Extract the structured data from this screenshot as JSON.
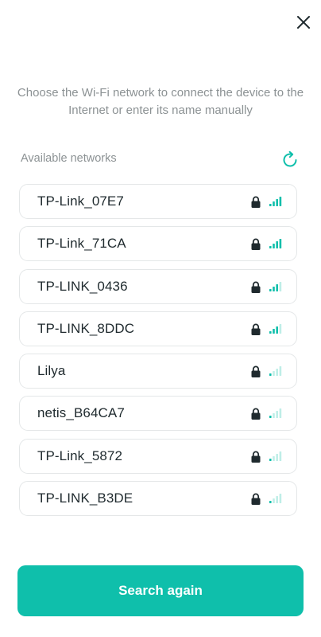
{
  "header": {
    "close_icon": "close-icon"
  },
  "instruction": "Choose the Wi-Fi network to connect the device to the Internet or enter its name manually",
  "networks_section": {
    "title": "Available networks",
    "refresh_icon": "refresh-icon"
  },
  "networks": [
    {
      "name": "TP-Link_07E7",
      "secured": true,
      "signal_bars": 4
    },
    {
      "name": "TP-Link_71CA",
      "secured": true,
      "signal_bars": 4
    },
    {
      "name": "TP-LINK_0436",
      "secured": true,
      "signal_bars": 3
    },
    {
      "name": "TP-LINK_8DDC",
      "secured": true,
      "signal_bars": 3
    },
    {
      "name": "Lilya",
      "secured": true,
      "signal_bars": 1
    },
    {
      "name": "netis_B64CA7",
      "secured": true,
      "signal_bars": 1
    },
    {
      "name": "TP-Link_5872",
      "secured": true,
      "signal_bars": 1
    },
    {
      "name": "TP-LINK_B3DE",
      "secured": true,
      "signal_bars": 1
    }
  ],
  "footer": {
    "search_again_label": "Search again"
  },
  "colors": {
    "accent": "#0fbfab",
    "signal_active": "#0fbfab",
    "signal_inactive": "#bfeee7",
    "lock": "#1f2a2e",
    "muted_text": "#8c9294"
  }
}
